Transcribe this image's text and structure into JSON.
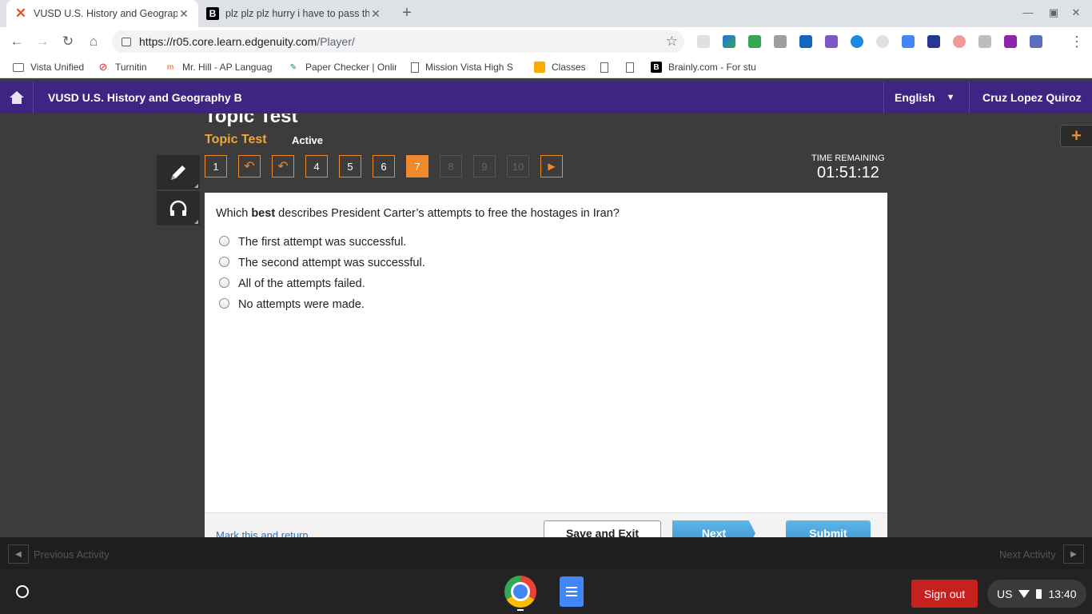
{
  "browser": {
    "tabs": [
      {
        "title": "VUSD U.S. History and Geography",
        "favicon": "edgenuity-x"
      },
      {
        "title": "plz plz plz hurry i have to pass th",
        "favicon": "brainly-b"
      }
    ],
    "url_host": "https://r05.core.learn.edgenuity.com",
    "url_path": "/Player/",
    "bookmarks": [
      {
        "label": "Vista Unified",
        "icon": "folder-icon"
      },
      {
        "label": "Turnitin",
        "icon": "turnitin-icon"
      },
      {
        "label": "Mr. Hill - AP Languag",
        "icon": "site-icon"
      },
      {
        "label": "Paper Checker | Onlin",
        "icon": "site-icon"
      },
      {
        "label": "Mission Vista High S",
        "icon": "page-icon"
      },
      {
        "label": "Classes",
        "icon": "classroom-icon"
      },
      {
        "label": "",
        "icon": "page-icon"
      },
      {
        "label": "",
        "icon": "page-icon"
      },
      {
        "label": "Brainly.com - For stu",
        "icon": "brainly-icon"
      }
    ]
  },
  "header": {
    "course": "VUSD U.S. History and Geography B",
    "language": "English",
    "user": "Cruz Lopez Quiroz"
  },
  "activity": {
    "big_title": "Topic Test",
    "title": "Topic Test",
    "status": "Active",
    "questions": [
      "1",
      "↶",
      "↶",
      "4",
      "5",
      "6",
      "7",
      "8",
      "9",
      "10"
    ],
    "current_question": "7",
    "time_label": "TIME REMAINING",
    "time_value": "01:51:12"
  },
  "question": {
    "prefix": "Which ",
    "emphasis": "best",
    "suffix": " describes President Carter’s attempts to free the hostages in Iran?",
    "options": [
      "The first attempt was successful.",
      "The second attempt was successful.",
      "All of the attempts failed.",
      "No attempts were made."
    ]
  },
  "footer": {
    "mark_return": "Mark this and return",
    "save_exit": "Save and Exit",
    "next": "Next",
    "submit": "Submit"
  },
  "activity_nav": {
    "previous": "Previous Activity",
    "next": "Next Activity"
  },
  "shelf": {
    "sign_out": "Sign out",
    "keyboard": "US",
    "clock": "13:40"
  },
  "colors": {
    "header_bg": "#3e2483",
    "accent_orange": "#f0892a",
    "button_blue": "#3a93cf",
    "sign_out_red": "#c5221f"
  }
}
